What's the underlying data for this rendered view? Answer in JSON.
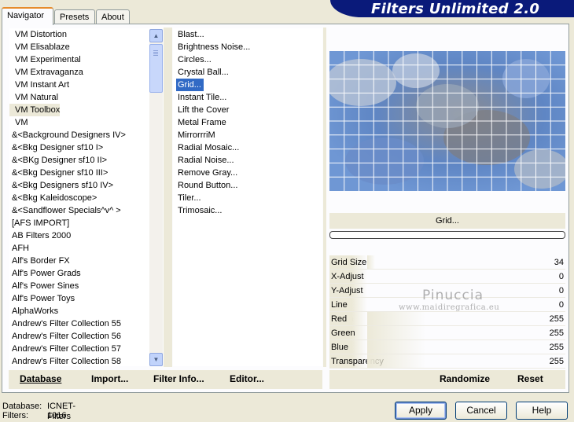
{
  "banner": {
    "title": "Filters Unlimited 2.0"
  },
  "tabs": [
    {
      "label": "Navigator",
      "active": true
    },
    {
      "label": "Presets",
      "active": false
    },
    {
      "label": "About",
      "active": false
    }
  ],
  "categories": {
    "selected_index": 6,
    "items": [
      "VM Distortion",
      "VM Elisablaze",
      "VM Experimental",
      "VM Extravaganza",
      "VM Instant Art",
      "VM Natural",
      "VM Toolbox",
      "VM",
      "&<Background Designers IV>",
      "&<Bkg Designer sf10 I>",
      "&<BKg Designer sf10 II>",
      "&<Bkg Designer sf10 III>",
      "&<Bkg Designers sf10 IV>",
      "&<Bkg Kaleidoscope>",
      "&<Sandflower Specials^v^ >",
      "[AFS IMPORT]",
      "AB Filters 2000",
      "AFH",
      "Alf's Border FX",
      "Alf's Power Grads",
      "Alf's Power Sines",
      "Alf's Power Toys",
      "AlphaWorks",
      "Andrew's Filter Collection 55",
      "Andrew's Filter Collection 56",
      "Andrew's Filter Collection 57",
      "Andrew's Filter Collection 58"
    ]
  },
  "filters": {
    "selected_index": 4,
    "items": [
      "Blast...",
      "Brightness Noise...",
      "Circles...",
      "Crystal Ball...",
      "Grid...",
      "Instant Tile...",
      "Lift the Cover",
      "Metal Frame",
      "MirrorrriM",
      "Radial Mosaic...",
      "Radial Noise...",
      "Remove Gray...",
      "Round Button...",
      "Tiler...",
      "Trimosaic..."
    ]
  },
  "preview": {
    "label": "Grid...",
    "progress": 0
  },
  "params": [
    {
      "name": "Grid Size",
      "value": "34",
      "max": 255
    },
    {
      "name": "X-Adjust",
      "value": "0",
      "max": 255
    },
    {
      "name": "Y-Adjust",
      "value": "0",
      "max": 255
    },
    {
      "name": "Line Width",
      "value": "0",
      "max": 255
    },
    {
      "name": "Red",
      "value": "255",
      "max": 255
    },
    {
      "name": "Green",
      "value": "255",
      "max": 255
    },
    {
      "name": "Blue",
      "value": "255",
      "max": 255
    },
    {
      "name": "Transparency",
      "value": "255",
      "max": 255
    }
  ],
  "bottom_links": {
    "database": "Database",
    "import": "Import...",
    "filter_info": "Filter Info...",
    "editor": "Editor...",
    "randomize": "Randomize",
    "reset": "Reset"
  },
  "watermark": {
    "name": "Pinuccia",
    "site": "www.maidiregrafica.eu"
  },
  "status": {
    "database_label": "Database:",
    "database_value": "ICNET-Filters",
    "filters_label": "Filters:",
    "filters_value": "1016"
  },
  "buttons": {
    "apply": "Apply",
    "cancel": "Cancel",
    "help": "Help"
  },
  "colors": {
    "banner": "#0a1a7a",
    "selection": "#316ac5",
    "dialog": "#ece9d8"
  }
}
